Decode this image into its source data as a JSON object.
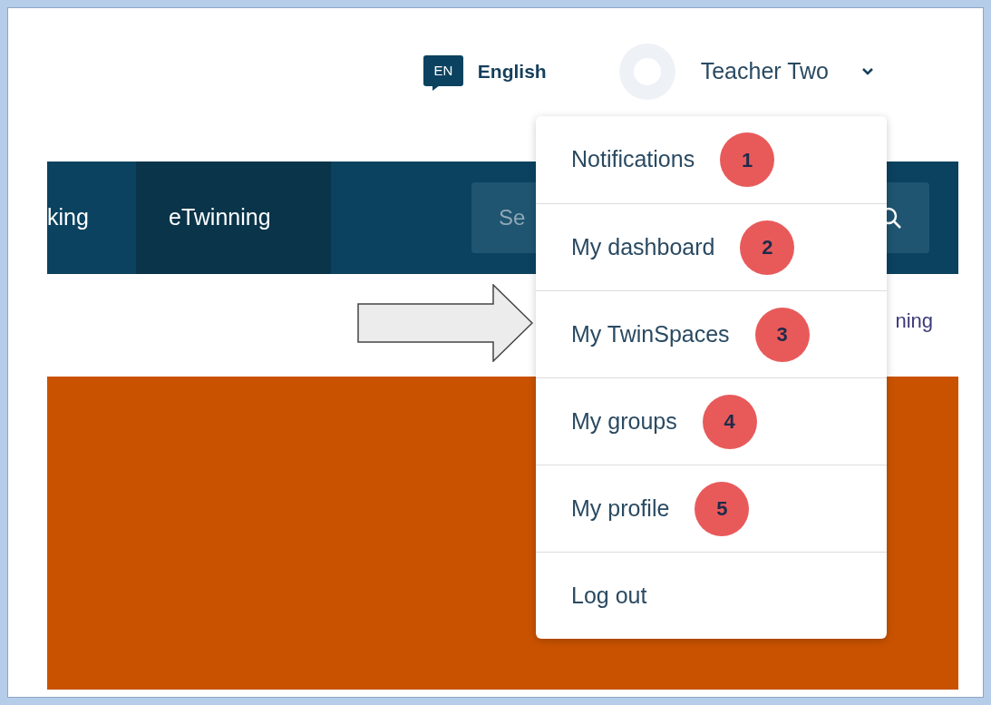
{
  "header": {
    "language": {
      "code": "EN",
      "label": "English"
    },
    "user": {
      "name": "Teacher Two"
    }
  },
  "nav": {
    "items": [
      {
        "label": "king",
        "selected": false
      },
      {
        "label": "eTwinning",
        "selected": true
      }
    ],
    "search": {
      "placeholder": "Se"
    }
  },
  "breadcrumb": {
    "text": "ning"
  },
  "user_menu": {
    "items": [
      {
        "label": "Notifications",
        "badge": "1"
      },
      {
        "label": "My dashboard",
        "badge": "2"
      },
      {
        "label": "My TwinSpaces",
        "badge": "3"
      },
      {
        "label": "My groups",
        "badge": "4"
      },
      {
        "label": "My profile",
        "badge": "5"
      },
      {
        "label": "Log out"
      }
    ]
  }
}
